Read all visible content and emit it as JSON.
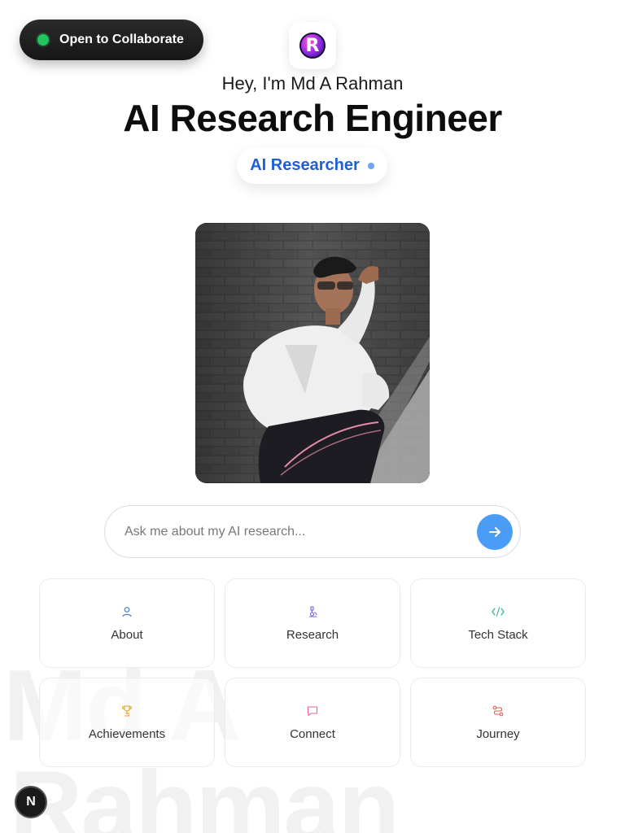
{
  "watermark": {
    "line1": "Md A",
    "line2": "Rahman"
  },
  "collab": {
    "label": "Open to Collaborate",
    "status_color": "#22c55e"
  },
  "logo": {
    "letter": "R"
  },
  "hero": {
    "greeting": "Hey, I'm Md A Rahman",
    "title": "AI Research Engineer",
    "role": "AI Researcher"
  },
  "photo": {
    "alt": "Portrait photo"
  },
  "ask": {
    "placeholder": "Ask me about my AI research..."
  },
  "cards": [
    {
      "label": "About",
      "icon": "user-icon",
      "color": "#4a7fd8"
    },
    {
      "label": "Research",
      "icon": "microscope-icon",
      "color": "#7a5af0"
    },
    {
      "label": "Tech Stack",
      "icon": "code-icon",
      "color": "#2bb07a"
    },
    {
      "label": "Achievements",
      "icon": "trophy-icon",
      "color": "#e8a317"
    },
    {
      "label": "Connect",
      "icon": "message-icon",
      "color": "#e0609f"
    },
    {
      "label": "Journey",
      "icon": "route-icon",
      "color": "#e05a4e"
    }
  ],
  "nbadge": {
    "letter": "N"
  }
}
